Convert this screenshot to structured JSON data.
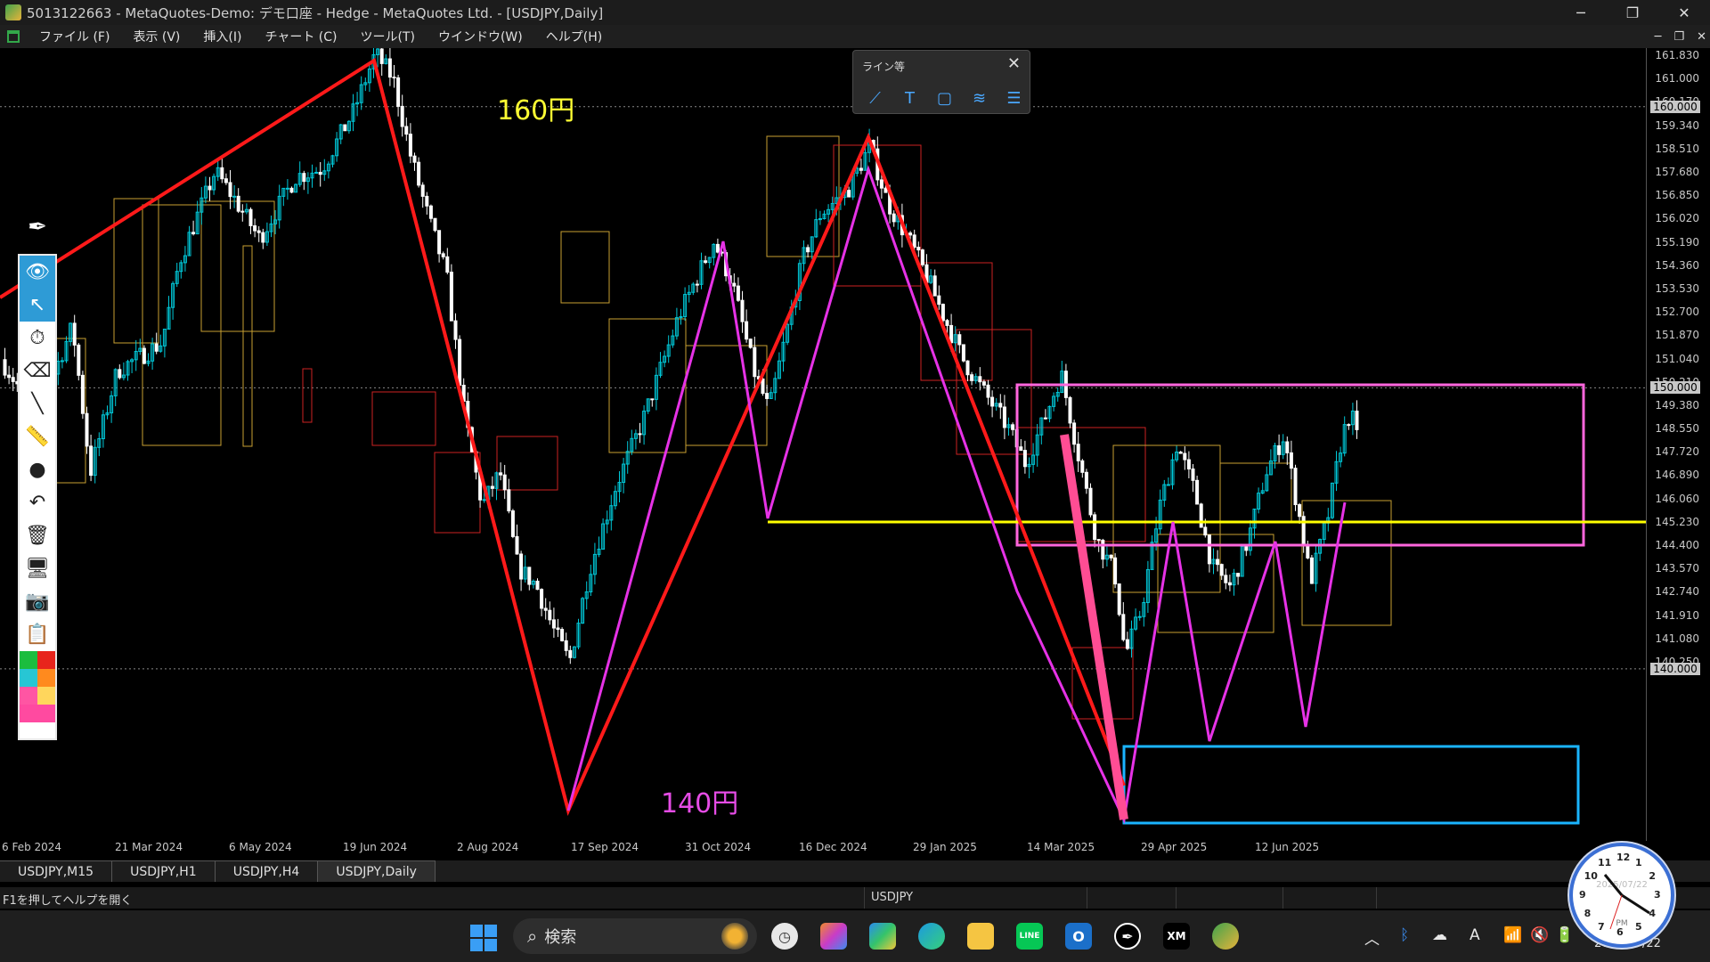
{
  "window": {
    "title": "5013122663 - MetaQuotes-Demo: デモ口座 - Hedge - MetaQuotes Ltd. - [USDJPY,Daily]",
    "minimize_glyph": "─",
    "restore_glyph": "❐",
    "close_glyph": "✕"
  },
  "menu": {
    "items": [
      "ファイル (F)",
      "表示 (V)",
      "挿入(I)",
      "チャート (C)",
      "ツール(T)",
      "ウインドウ(W)",
      "ヘルプ(H)"
    ],
    "mdi_min": "─",
    "mdi_restore": "❐",
    "mdi_close": "✕"
  },
  "line_toolbar": {
    "title": "ライン等",
    "close": "✕",
    "tools": [
      "trendline-icon",
      "text-icon",
      "rectangle-icon",
      "fibonacci-icon",
      "channel-icon"
    ]
  },
  "palette": {
    "tools": [
      "eye-icon",
      "pointer-icon",
      "timer-icon",
      "eraser-icon",
      "line-icon",
      "ruler-icon",
      "dot-icon",
      "undo-icon",
      "trash-icon",
      "monitor-icon",
      "camera-icon",
      "clipboard-icon"
    ],
    "colors": [
      "#1bbd3f",
      "#e8241c",
      "#27c6d4",
      "#ff8a1e",
      "#ff55a3",
      "#ffd65c",
      "#ff4aa0",
      "#ff4aa0"
    ]
  },
  "chart": {
    "symbol": "USDJPY",
    "timeframe": "Daily",
    "annotation_160": "160円",
    "annotation_140": "140円",
    "annotation_160_color": "#ffff33",
    "annotation_140_color": "#e64ce6",
    "price_labels": [
      "161.830",
      "161.000",
      "160.170",
      "159.340",
      "158.510",
      "157.680",
      "156.850",
      "156.020",
      "155.190",
      "154.360",
      "153.530",
      "152.700",
      "151.870",
      "151.040",
      "150.210",
      "149.380",
      "148.550",
      "147.720",
      "146.890",
      "146.060",
      "145.230",
      "144.400",
      "143.570",
      "142.740",
      "141.910",
      "141.080",
      "140.250"
    ],
    "highlight_prices": [
      "160.000",
      "150.000",
      "140.000"
    ],
    "time_labels": [
      "6 Feb 2024",
      "21 Mar 2024",
      "6 May 2024",
      "19 Jun 2024",
      "2 Aug 2024",
      "17 Sep 2024",
      "31 Oct 2024",
      "16 Dec 2024",
      "29 Jan 2025",
      "14 Mar 2025",
      "29 Apr 2025",
      "12 Jun 2025"
    ],
    "candle_up_color": "#00c8d8",
    "candle_down_color": "#ffffff",
    "red_zigzag_color": "#ff1a1a",
    "magenta_zigzag_color": "#e632e6",
    "pink_line_color": "#ff4d94",
    "support_line_color": "#ffff00",
    "box_pink_color": "#ff66dd",
    "box_blue_color": "#1ab4ff"
  },
  "tabs": [
    "USDJPY,M15",
    "USDJPY,H1",
    "USDJPY,H4",
    "USDJPY,Daily"
  ],
  "status": {
    "help": "F1を押してヘルプを開く",
    "symbol": "USDJPY"
  },
  "taskbar": {
    "search_placeholder": "検索",
    "clock_date": "2025/07/22",
    "clock_pm": "PM",
    "date_text": "2025/07/22",
    "clock_numbers": [
      "12",
      "1",
      "2",
      "3",
      "4",
      "5",
      "6",
      "7",
      "8",
      "9",
      "10",
      "11"
    ],
    "xm_label": "XM",
    "line_label": "LINE",
    "outlook_label": "O",
    "tray_ime": "A"
  }
}
